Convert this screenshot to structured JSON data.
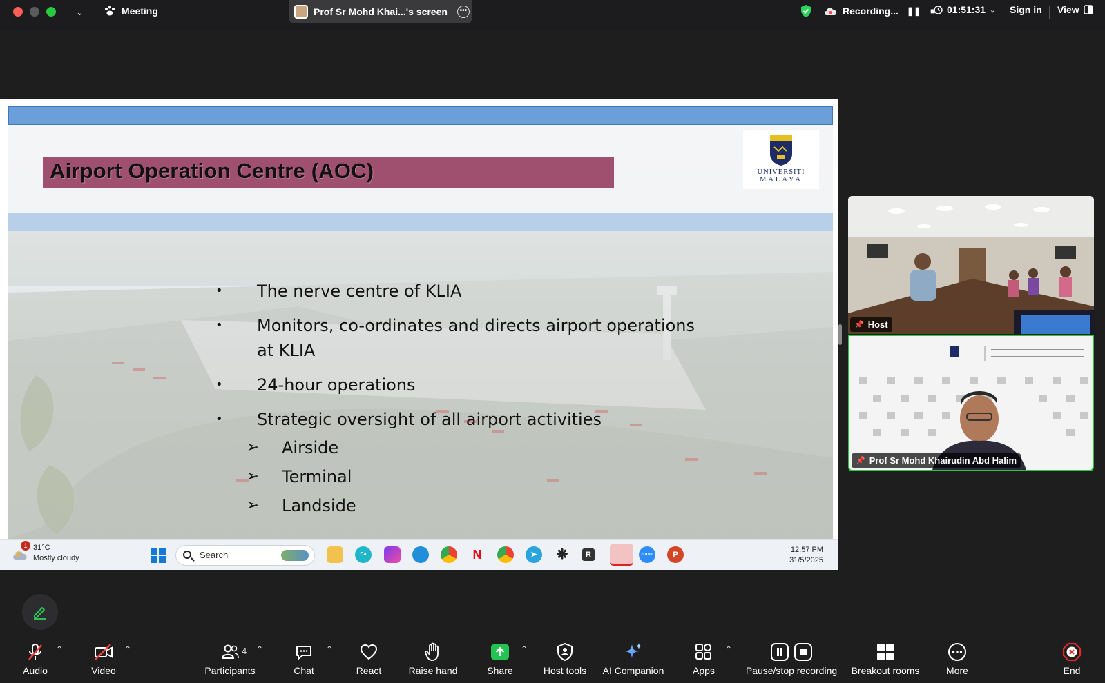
{
  "topbar": {
    "meeting_label": "Meeting",
    "share_title": "Prof Sr Mohd Khai...'s screen",
    "recording_label": "Recording...",
    "timer": "01:51:31",
    "sign_in": "Sign in",
    "view": "View"
  },
  "slide": {
    "title": "Airport Operation Centre (AOC)",
    "logo_text_line1": "UNIVERSITI",
    "logo_text_line2": "MALAYA",
    "bullets": [
      "The nerve centre of KLIA",
      "Monitors, co-ordinates and directs   airport operations at KLIA",
      "24-hour operations",
      "Strategic oversight of all airport activities"
    ],
    "sub_bullets": [
      "Airside",
      "Terminal",
      "Landside"
    ]
  },
  "taskbar": {
    "weather_temp": "31°C",
    "weather_desc": "Mostly cloudy",
    "weather_badge": "1",
    "search_placeholder": "Search",
    "time": "12:57 PM",
    "date": "31/5/2025"
  },
  "participants": {
    "host_label": "Host",
    "speaker_name": "Prof Sr Mohd Khairudin Abd Halim"
  },
  "toolbar": {
    "audio": "Audio",
    "video": "Video",
    "participants": "Participants",
    "participant_count": "4",
    "chat": "Chat",
    "react": "React",
    "raise_hand": "Raise hand",
    "share": "Share",
    "host_tools": "Host tools",
    "ai_companion": "AI Companion",
    "apps": "Apps",
    "pause_stop": "Pause/stop recording",
    "breakout": "Breakout rooms",
    "more": "More",
    "end": "End"
  },
  "colors": {
    "accent_green": "#27c93f",
    "title_bar": "#a0506f",
    "slide_band": "#6a9fd9",
    "end_red": "#e02828"
  }
}
